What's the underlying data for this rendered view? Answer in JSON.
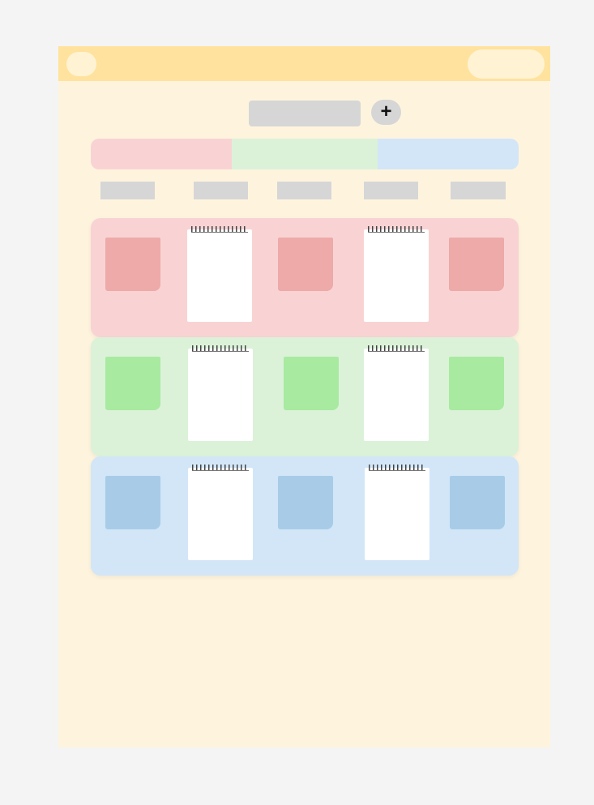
{
  "header": {
    "menu_icon": "menu-pill",
    "account_icon": "account-pill",
    "color": "#ffe29d"
  },
  "toolbar": {
    "add_label": "+"
  },
  "tabs": [
    {
      "color": "#f9d3d3"
    },
    {
      "color": "#dbf2d9"
    },
    {
      "color": "#d2e6f8"
    }
  ],
  "rows": [
    {
      "row_color": "#f9d3d3",
      "sticky_color": "#eea9a9"
    },
    {
      "row_color": "#dbf2d9",
      "sticky_color": "#a7eaa0"
    },
    {
      "row_color": "#d2e6f8",
      "sticky_color": "#a8cce7"
    }
  ]
}
